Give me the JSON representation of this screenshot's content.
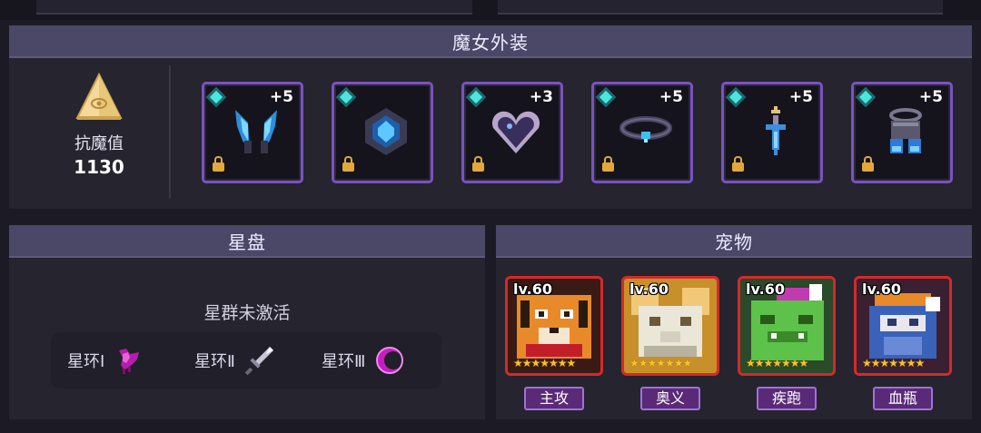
{
  "outfit": {
    "title": "魔女外装",
    "resist_label": "抗魔值",
    "resist_value": "1130",
    "slots": [
      {
        "name": "horns",
        "plus": "+5"
      },
      {
        "name": "amulet",
        "plus": ""
      },
      {
        "name": "heart",
        "plus": "+3"
      },
      {
        "name": "collar",
        "plus": "+5"
      },
      {
        "name": "sword-pendant",
        "plus": "+5"
      },
      {
        "name": "boots",
        "plus": "+5"
      }
    ]
  },
  "star_disc": {
    "title": "星盘",
    "status": "星群未激活",
    "rings": [
      {
        "label": "星环Ⅰ",
        "icon": "bird-icon"
      },
      {
        "label": "星环Ⅱ",
        "icon": "sword-icon"
      },
      {
        "label": "星环Ⅲ",
        "icon": "crescent-icon"
      }
    ]
  },
  "pets": {
    "title": "宠物",
    "items": [
      {
        "level": "lv.60",
        "stars": 7,
        "tag": "主攻",
        "icon": "tiger-icon"
      },
      {
        "level": "lv.60",
        "stars": 7,
        "tag": "奥义",
        "icon": "white-beast-icon"
      },
      {
        "level": "lv.60",
        "stars": 7,
        "tag": "疾跑",
        "icon": "green-beast-icon"
      },
      {
        "level": "lv.60",
        "stars": 7,
        "tag": "血瓶",
        "icon": "knight-icon"
      }
    ]
  },
  "colors": {
    "accent_header": "#4a4866",
    "slot_border": "#7a52c0",
    "pet_border": "#d42a2a",
    "gem": "#4ee6dc",
    "star": "#f6c22c"
  }
}
